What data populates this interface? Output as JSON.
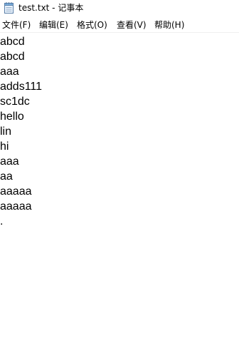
{
  "window": {
    "title": "test.txt - 记事本",
    "icon": "notepad-icon"
  },
  "menu": {
    "items": [
      "文件(F)",
      "编辑(E)",
      "格式(O)",
      "查看(V)",
      "帮助(H)"
    ]
  },
  "editor": {
    "lines": [
      "abcd",
      "abcd",
      "aaa",
      "adds111",
      "sc1dc",
      "hello",
      "lin",
      "hi",
      "aaa",
      "aa",
      "aaaaa",
      "aaaaa",
      "."
    ]
  }
}
